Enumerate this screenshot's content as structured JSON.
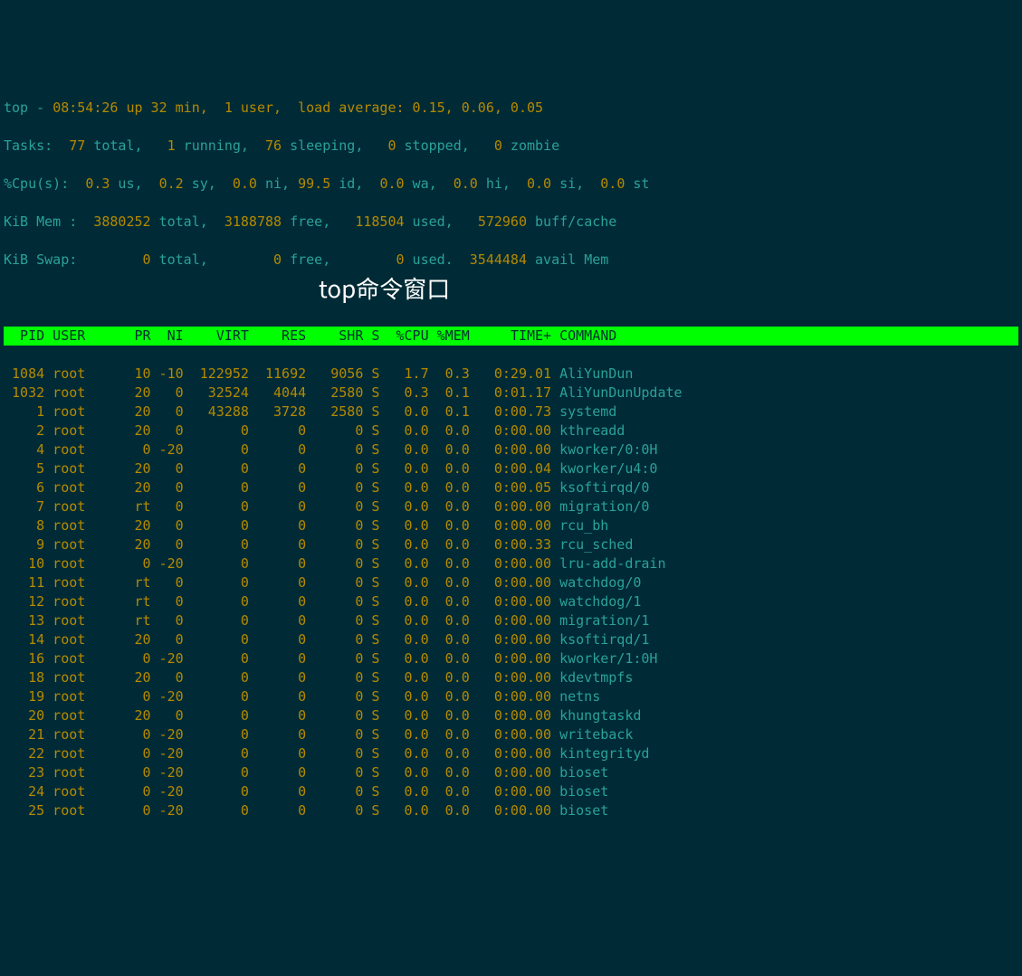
{
  "summary": {
    "line1_a": "top - ",
    "line1_b": "08:54:26 up 32 min,  1 user,  load average: 0.15, 0.06, 0.05",
    "tasks": {
      "label": "Tasks:",
      "total": "77",
      "total_l": " total,",
      "running": "1",
      "running_l": " running,",
      "sleeping": "76",
      "sleeping_l": " sleeping,",
      "stopped": "0",
      "stopped_l": " stopped,",
      "zombie": "0",
      "zombie_l": " zombie"
    },
    "cpu": {
      "label": "%Cpu(s):",
      "us": "0.3",
      "us_l": " us,",
      "sy": "0.2",
      "sy_l": " sy,",
      "ni": "0.0",
      "ni_l": " ni,",
      "id": "99.5",
      "id_l": " id,",
      "wa": "0.0",
      "wa_l": " wa,",
      "hi": "0.0",
      "hi_l": " hi,",
      "si": "0.0",
      "si_l": " si,",
      "st": "0.0",
      "st_l": " st"
    },
    "mem": {
      "label": "KiB Mem :",
      "total": "3880252",
      "total_l": " total,",
      "free": "3188788",
      "free_l": " free,",
      "used": "118504",
      "used_l": " used,",
      "buff": "572960",
      "buff_l": " buff/cache"
    },
    "swap": {
      "label": "KiB Swap:",
      "total": "0",
      "total_l": " total,",
      "free": "0",
      "free_l": " free,",
      "used": "0",
      "used_l": " used.",
      "avail": "3544484",
      "avail_l": " avail Mem"
    }
  },
  "columns": "  PID USER      PR  NI    VIRT    RES    SHR S  %CPU %MEM     TIME+ COMMAND",
  "processes": [
    {
      "pid": "1084",
      "user": "root",
      "pr": "10",
      "ni": "-10",
      "virt": "122952",
      "res": "11692",
      "shr": "9056",
      "s": "S",
      "cpu": "1.7",
      "mem": "0.3",
      "time": "0:29.01",
      "cmd": "AliYunDun"
    },
    {
      "pid": "1032",
      "user": "root",
      "pr": "20",
      "ni": "0",
      "virt": "32524",
      "res": "4044",
      "shr": "2580",
      "s": "S",
      "cpu": "0.3",
      "mem": "0.1",
      "time": "0:01.17",
      "cmd": "AliYunDunUpdate"
    },
    {
      "pid": "1",
      "user": "root",
      "pr": "20",
      "ni": "0",
      "virt": "43288",
      "res": "3728",
      "shr": "2580",
      "s": "S",
      "cpu": "0.0",
      "mem": "0.1",
      "time": "0:00.73",
      "cmd": "systemd"
    },
    {
      "pid": "2",
      "user": "root",
      "pr": "20",
      "ni": "0",
      "virt": "0",
      "res": "0",
      "shr": "0",
      "s": "S",
      "cpu": "0.0",
      "mem": "0.0",
      "time": "0:00.00",
      "cmd": "kthreadd"
    },
    {
      "pid": "4",
      "user": "root",
      "pr": "0",
      "ni": "-20",
      "virt": "0",
      "res": "0",
      "shr": "0",
      "s": "S",
      "cpu": "0.0",
      "mem": "0.0",
      "time": "0:00.00",
      "cmd": "kworker/0:0H"
    },
    {
      "pid": "5",
      "user": "root",
      "pr": "20",
      "ni": "0",
      "virt": "0",
      "res": "0",
      "shr": "0",
      "s": "S",
      "cpu": "0.0",
      "mem": "0.0",
      "time": "0:00.04",
      "cmd": "kworker/u4:0"
    },
    {
      "pid": "6",
      "user": "root",
      "pr": "20",
      "ni": "0",
      "virt": "0",
      "res": "0",
      "shr": "0",
      "s": "S",
      "cpu": "0.0",
      "mem": "0.0",
      "time": "0:00.05",
      "cmd": "ksoftirqd/0"
    },
    {
      "pid": "7",
      "user": "root",
      "pr": "rt",
      "ni": "0",
      "virt": "0",
      "res": "0",
      "shr": "0",
      "s": "S",
      "cpu": "0.0",
      "mem": "0.0",
      "time": "0:00.00",
      "cmd": "migration/0"
    },
    {
      "pid": "8",
      "user": "root",
      "pr": "20",
      "ni": "0",
      "virt": "0",
      "res": "0",
      "shr": "0",
      "s": "S",
      "cpu": "0.0",
      "mem": "0.0",
      "time": "0:00.00",
      "cmd": "rcu_bh"
    },
    {
      "pid": "9",
      "user": "root",
      "pr": "20",
      "ni": "0",
      "virt": "0",
      "res": "0",
      "shr": "0",
      "s": "S",
      "cpu": "0.0",
      "mem": "0.0",
      "time": "0:00.33",
      "cmd": "rcu_sched"
    },
    {
      "pid": "10",
      "user": "root",
      "pr": "0",
      "ni": "-20",
      "virt": "0",
      "res": "0",
      "shr": "0",
      "s": "S",
      "cpu": "0.0",
      "mem": "0.0",
      "time": "0:00.00",
      "cmd": "lru-add-drain"
    },
    {
      "pid": "11",
      "user": "root",
      "pr": "rt",
      "ni": "0",
      "virt": "0",
      "res": "0",
      "shr": "0",
      "s": "S",
      "cpu": "0.0",
      "mem": "0.0",
      "time": "0:00.00",
      "cmd": "watchdog/0"
    },
    {
      "pid": "12",
      "user": "root",
      "pr": "rt",
      "ni": "0",
      "virt": "0",
      "res": "0",
      "shr": "0",
      "s": "S",
      "cpu": "0.0",
      "mem": "0.0",
      "time": "0:00.00",
      "cmd": "watchdog/1"
    },
    {
      "pid": "13",
      "user": "root",
      "pr": "rt",
      "ni": "0",
      "virt": "0",
      "res": "0",
      "shr": "0",
      "s": "S",
      "cpu": "0.0",
      "mem": "0.0",
      "time": "0:00.00",
      "cmd": "migration/1"
    },
    {
      "pid": "14",
      "user": "root",
      "pr": "20",
      "ni": "0",
      "virt": "0",
      "res": "0",
      "shr": "0",
      "s": "S",
      "cpu": "0.0",
      "mem": "0.0",
      "time": "0:00.00",
      "cmd": "ksoftirqd/1"
    },
    {
      "pid": "16",
      "user": "root",
      "pr": "0",
      "ni": "-20",
      "virt": "0",
      "res": "0",
      "shr": "0",
      "s": "S",
      "cpu": "0.0",
      "mem": "0.0",
      "time": "0:00.00",
      "cmd": "kworker/1:0H"
    },
    {
      "pid": "18",
      "user": "root",
      "pr": "20",
      "ni": "0",
      "virt": "0",
      "res": "0",
      "shr": "0",
      "s": "S",
      "cpu": "0.0",
      "mem": "0.0",
      "time": "0:00.00",
      "cmd": "kdevtmpfs"
    },
    {
      "pid": "19",
      "user": "root",
      "pr": "0",
      "ni": "-20",
      "virt": "0",
      "res": "0",
      "shr": "0",
      "s": "S",
      "cpu": "0.0",
      "mem": "0.0",
      "time": "0:00.00",
      "cmd": "netns"
    },
    {
      "pid": "20",
      "user": "root",
      "pr": "20",
      "ni": "0",
      "virt": "0",
      "res": "0",
      "shr": "0",
      "s": "S",
      "cpu": "0.0",
      "mem": "0.0",
      "time": "0:00.00",
      "cmd": "khungtaskd"
    },
    {
      "pid": "21",
      "user": "root",
      "pr": "0",
      "ni": "-20",
      "virt": "0",
      "res": "0",
      "shr": "0",
      "s": "S",
      "cpu": "0.0",
      "mem": "0.0",
      "time": "0:00.00",
      "cmd": "writeback"
    },
    {
      "pid": "22",
      "user": "root",
      "pr": "0",
      "ni": "-20",
      "virt": "0",
      "res": "0",
      "shr": "0",
      "s": "S",
      "cpu": "0.0",
      "mem": "0.0",
      "time": "0:00.00",
      "cmd": "kintegrityd"
    },
    {
      "pid": "23",
      "user": "root",
      "pr": "0",
      "ni": "-20",
      "virt": "0",
      "res": "0",
      "shr": "0",
      "s": "S",
      "cpu": "0.0",
      "mem": "0.0",
      "time": "0:00.00",
      "cmd": "bioset"
    },
    {
      "pid": "24",
      "user": "root",
      "pr": "0",
      "ni": "-20",
      "virt": "0",
      "res": "0",
      "shr": "0",
      "s": "S",
      "cpu": "0.0",
      "mem": "0.0",
      "time": "0:00.00",
      "cmd": "bioset"
    },
    {
      "pid": "25",
      "user": "root",
      "pr": "0",
      "ni": "-20",
      "virt": "0",
      "res": "0",
      "shr": "0",
      "s": "S",
      "cpu": "0.0",
      "mem": "0.0",
      "time": "0:00.00",
      "cmd": "bioset"
    }
  ],
  "overlay_text": "top命令窗口"
}
